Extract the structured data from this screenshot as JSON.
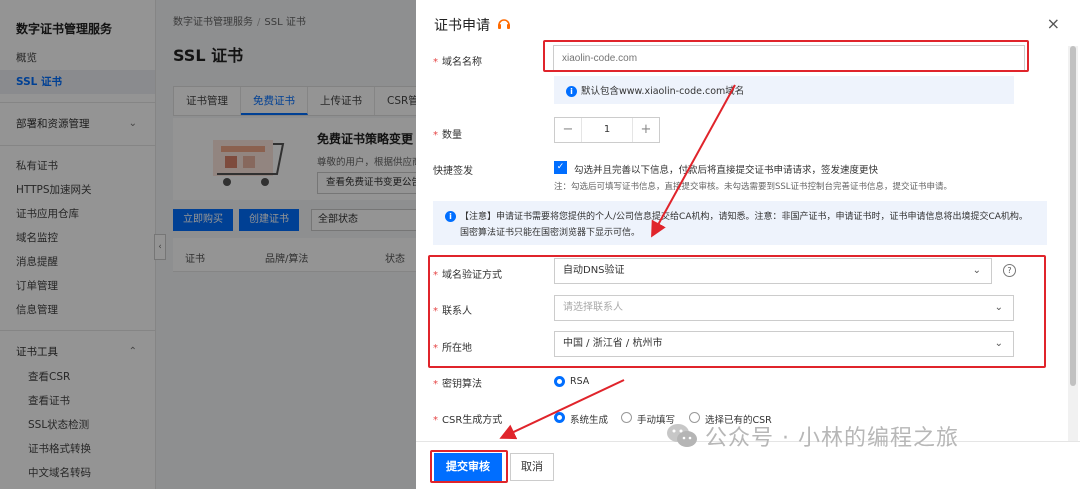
{
  "sidebar": {
    "title": "数字证书管理服务",
    "items": [
      {
        "label": "概览"
      },
      {
        "label": "SSL 证书"
      }
    ],
    "group_deploy": "部署和资源管理",
    "items2": [
      {
        "label": "私有证书"
      },
      {
        "label": "HTTPS加速网关"
      },
      {
        "label": "证书应用仓库"
      },
      {
        "label": "域名监控"
      },
      {
        "label": "消息提醒"
      },
      {
        "label": "订单管理"
      },
      {
        "label": "信息管理"
      }
    ],
    "group_tools": "证书工具",
    "tools": [
      {
        "label": "查看CSR"
      },
      {
        "label": "查看证书"
      },
      {
        "label": "SSL状态检测"
      },
      {
        "label": "证书格式转换"
      },
      {
        "label": "中文域名转码"
      }
    ]
  },
  "main": {
    "breadcrumb": [
      "数字证书管理服务",
      "SSL 证书"
    ],
    "title": "SSL 证书",
    "tabs": [
      "证书管理",
      "免费证书",
      "上传证书",
      "CSR管"
    ],
    "promo": {
      "title": "免费证书策略变更",
      "subtitle": "尊敬的用户，根据供应商",
      "button": "查看免费证书变更公告"
    },
    "toolbar": {
      "buy": "立即购买",
      "create": "创建证书",
      "status_filter": "全部状态"
    },
    "table_headers": [
      "证书",
      "品牌/算法",
      "状态"
    ]
  },
  "modal": {
    "title": "证书申请",
    "domain": {
      "label": "域名名称",
      "placeholder": "xiaolin-code.com",
      "info": "默认包含www.xiaolin-code.com域名"
    },
    "quantity": {
      "label": "数量",
      "value": "1",
      "minus": "−",
      "plus": "+"
    },
    "quick": {
      "label": "快捷签发",
      "text": "勾选并且完善以下信息，付款后将直接提交证书申请请求，签发速度更快",
      "note": "注：勾选后可填写证书信息，直接提交审核。未勾选需要到SSL证书控制台完善证书信息，提交证书申请。"
    },
    "notice": {
      "line1": "【注意】申请证书需要将您提供的个人/公司信息提交给CA机构，请知悉。注意：非国产证书，申请证书时，证书申请信息将出境提交CA机构。",
      "line2": "国密算法证书只能在国密浏览器下显示可信。"
    },
    "verify": {
      "label": "域名验证方式",
      "value": "自动DNS验证"
    },
    "contact": {
      "label": "联系人",
      "placeholder": "请选择联系人"
    },
    "location": {
      "label": "所在地",
      "value": "中国 / 浙江省 / 杭州市"
    },
    "algorithm": {
      "label": "密钥算法",
      "option": "RSA"
    },
    "csr": {
      "label": "CSR生成方式",
      "options": [
        "系统生成",
        "手动填写",
        "选择已有的CSR"
      ]
    },
    "footer": {
      "submit": "提交审核",
      "cancel": "取消"
    },
    "close": "×",
    "help": "?"
  },
  "watermark": "公众号 · 小林的编程之旅",
  "colors": {
    "accent": "#006eff",
    "annotation": "#e0242b"
  }
}
